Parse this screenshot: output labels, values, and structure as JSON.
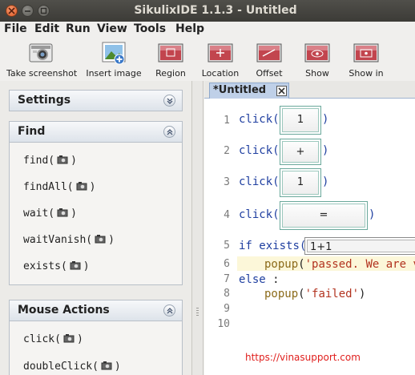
{
  "window": {
    "title": "SikulixIDE 1.1.3 - Untitled"
  },
  "menubar": {
    "items": [
      "File",
      "Edit",
      "Run",
      "View",
      "Tools",
      "Help"
    ]
  },
  "toolbar": {
    "buttons": [
      {
        "label": "Take screenshot",
        "icon": "camera-icon"
      },
      {
        "label": "Insert image",
        "icon": "insert-image-icon"
      },
      {
        "label": "Region",
        "icon": "region-icon"
      },
      {
        "label": "Location",
        "icon": "location-icon"
      },
      {
        "label": "Offset",
        "icon": "offset-icon"
      },
      {
        "label": "Show",
        "icon": "show-icon"
      },
      {
        "label": "Show in",
        "icon": "show-in-icon"
      }
    ]
  },
  "sidebar": {
    "sections": [
      {
        "title": "Settings",
        "state": "collapsed",
        "items": []
      },
      {
        "title": "Find",
        "state": "expanded",
        "items": [
          "find(",
          "findAll(",
          "wait(",
          "waitVanish(",
          "exists("
        ]
      },
      {
        "title": "Mouse Actions",
        "state": "expanded",
        "items": [
          "click(",
          "doubleClick("
        ]
      }
    ],
    "item_close": ")"
  },
  "editor": {
    "tab_label": "*Untitled",
    "line_numbers": [
      "1",
      "2",
      "3",
      "4",
      "5",
      "6",
      "7",
      "8",
      "9",
      "10"
    ],
    "lines": [
      {
        "text": "click(",
        "pattern": "1",
        "close": ")"
      },
      {
        "text": "click(",
        "pattern": "+",
        "close": ")"
      },
      {
        "text": "click(",
        "pattern": "1",
        "close": ")"
      },
      {
        "text": "click(",
        "pattern": "=",
        "close": ")"
      },
      {
        "keyword": "if",
        "text": "exists(",
        "pattern": "1+1"
      },
      {
        "func": "popup",
        "open": "(",
        "string": "'passed. We are vi"
      },
      {
        "keyword": "else",
        "text": ":"
      },
      {
        "func": "popup",
        "open": "(",
        "string": "'failed'",
        "close": ")"
      }
    ]
  },
  "watermark": "https://vinasupport.com",
  "colors": {
    "accent_tab": "#bfd0e8",
    "keyword": "#1f3fa0",
    "string": "#b2331f",
    "watermark": "#e0201e"
  }
}
